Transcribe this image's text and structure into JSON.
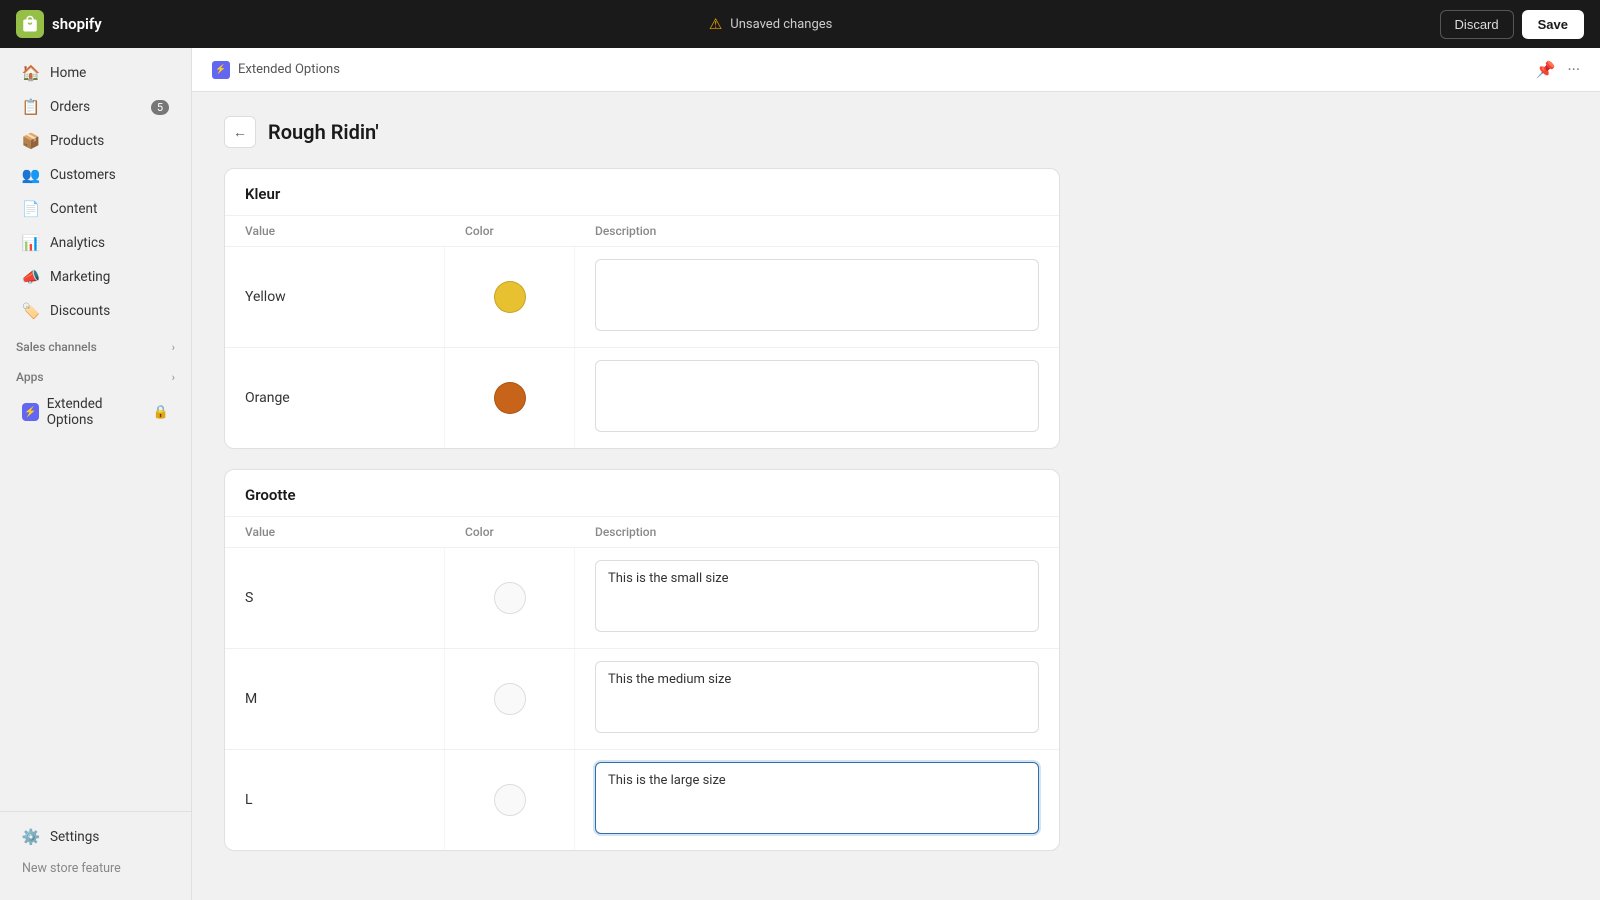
{
  "topbar": {
    "logo_text": "shopify",
    "unsaved_label": "Unsaved changes",
    "discard_label": "Discard",
    "save_label": "Save"
  },
  "sidebar": {
    "nav_items": [
      {
        "id": "home",
        "label": "Home",
        "icon": "🏠",
        "badge": null
      },
      {
        "id": "orders",
        "label": "Orders",
        "icon": "📋",
        "badge": "5"
      },
      {
        "id": "products",
        "label": "Products",
        "icon": "📦",
        "badge": null
      },
      {
        "id": "customers",
        "label": "Customers",
        "icon": "👥",
        "badge": null
      },
      {
        "id": "content",
        "label": "Content",
        "icon": "📄",
        "badge": null
      },
      {
        "id": "analytics",
        "label": "Analytics",
        "icon": "📊",
        "badge": null
      },
      {
        "id": "marketing",
        "label": "Marketing",
        "icon": "📣",
        "badge": null
      },
      {
        "id": "discounts",
        "label": "Discounts",
        "icon": "🏷️",
        "badge": null
      }
    ],
    "sales_channels_label": "Sales channels",
    "apps_label": "Apps",
    "extended_options_label": "Extended Options",
    "settings_label": "Settings",
    "new_store_label": "New store feature"
  },
  "sub_header": {
    "app_name": "Extended Options",
    "pin_icon": "📌",
    "more_icon": "···"
  },
  "page": {
    "title": "Rough Ridin'",
    "back_label": "←"
  },
  "kleur_section": {
    "title": "Kleur",
    "col_value": "Value",
    "col_color": "Color",
    "col_description": "Description",
    "rows": [
      {
        "value": "Yellow",
        "color": "#e8c130",
        "description": ""
      },
      {
        "value": "Orange",
        "color": "#c8631a",
        "description": ""
      }
    ]
  },
  "grootte_section": {
    "title": "Grootte",
    "col_value": "Value",
    "col_color": "Color",
    "col_description": "Description",
    "rows": [
      {
        "value": "S",
        "color": null,
        "description": "This is the small size",
        "focused": false
      },
      {
        "value": "M",
        "color": null,
        "description": "This the medium size",
        "focused": false
      },
      {
        "value": "L",
        "color": null,
        "description": "This is the large size",
        "focused": true
      }
    ]
  }
}
